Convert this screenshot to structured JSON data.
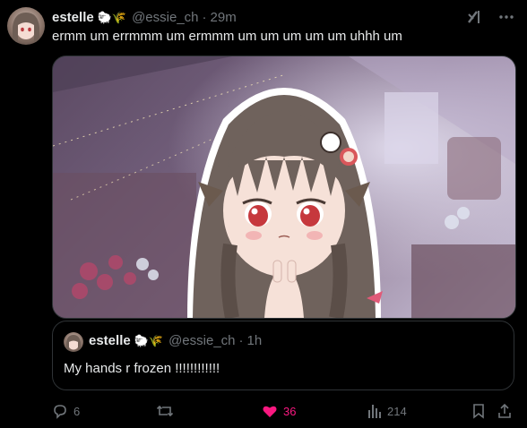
{
  "post": {
    "author_name": "estelle",
    "author_emoji": "🐑🌾",
    "handle": "@essie_ch",
    "separator": "·",
    "time": "29m",
    "text": "ermm um errmmm um ermmm um um um um um uhhh um"
  },
  "quoted": {
    "author_name": "estelle",
    "author_emoji": "🐑🌾",
    "handle": "@essie_ch",
    "separator": "·",
    "time": "1h",
    "text": "My hands r frozen !!!!!!!!!!!!"
  },
  "actions": {
    "replies": "6",
    "reposts": "",
    "likes": "36",
    "views": "214"
  },
  "colors": {
    "background": "#000000",
    "text": "#e7e9ea",
    "muted": "#71767b",
    "like": "#f91880",
    "border": "#2f3336"
  }
}
